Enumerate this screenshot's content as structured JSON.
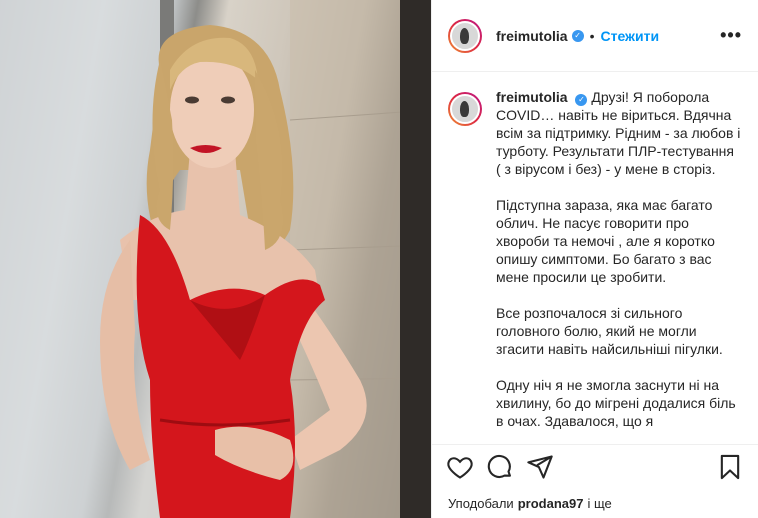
{
  "post": {
    "username": "freimutolia",
    "follow_label": "Стежити",
    "separator": "•",
    "more_label": "•••"
  },
  "caption": {
    "username": "freimutolia",
    "paragraphs": [
      "Друзі! Я поборола COVID… навіть не віриться. Вдячна всім за підтримку. Рідним - за любов і турботу. Результати ПЛР-тестування ( з вірусом і без) - у мене в сторіз.",
      "Підступна зараза, яка має багато облич. Не пасує говорити про хвороби та немочі , але я коротко опишу симптоми. Бо багато з вас мене просили це зробити.",
      "Все розпочалося зі сильного головного болю, який не могли згасити навіть найсильніші пігулки.",
      "Одну ніч я не змогла заснути ні на хвилину, бо до мігрені додалися біль в очах. Здавалося, що я"
    ]
  },
  "footer": {
    "liked_prefix": "Уподобали",
    "liked_user": "prodana97",
    "liked_suffix": "і ще"
  },
  "icons": {
    "verified": "verified-badge-icon",
    "like": "heart-icon",
    "comment": "comment-icon",
    "share": "share-icon",
    "save": "bookmark-icon"
  },
  "colors": {
    "accent": "#0095f6",
    "verified": "#3897f0",
    "dress": "#d4161c"
  }
}
